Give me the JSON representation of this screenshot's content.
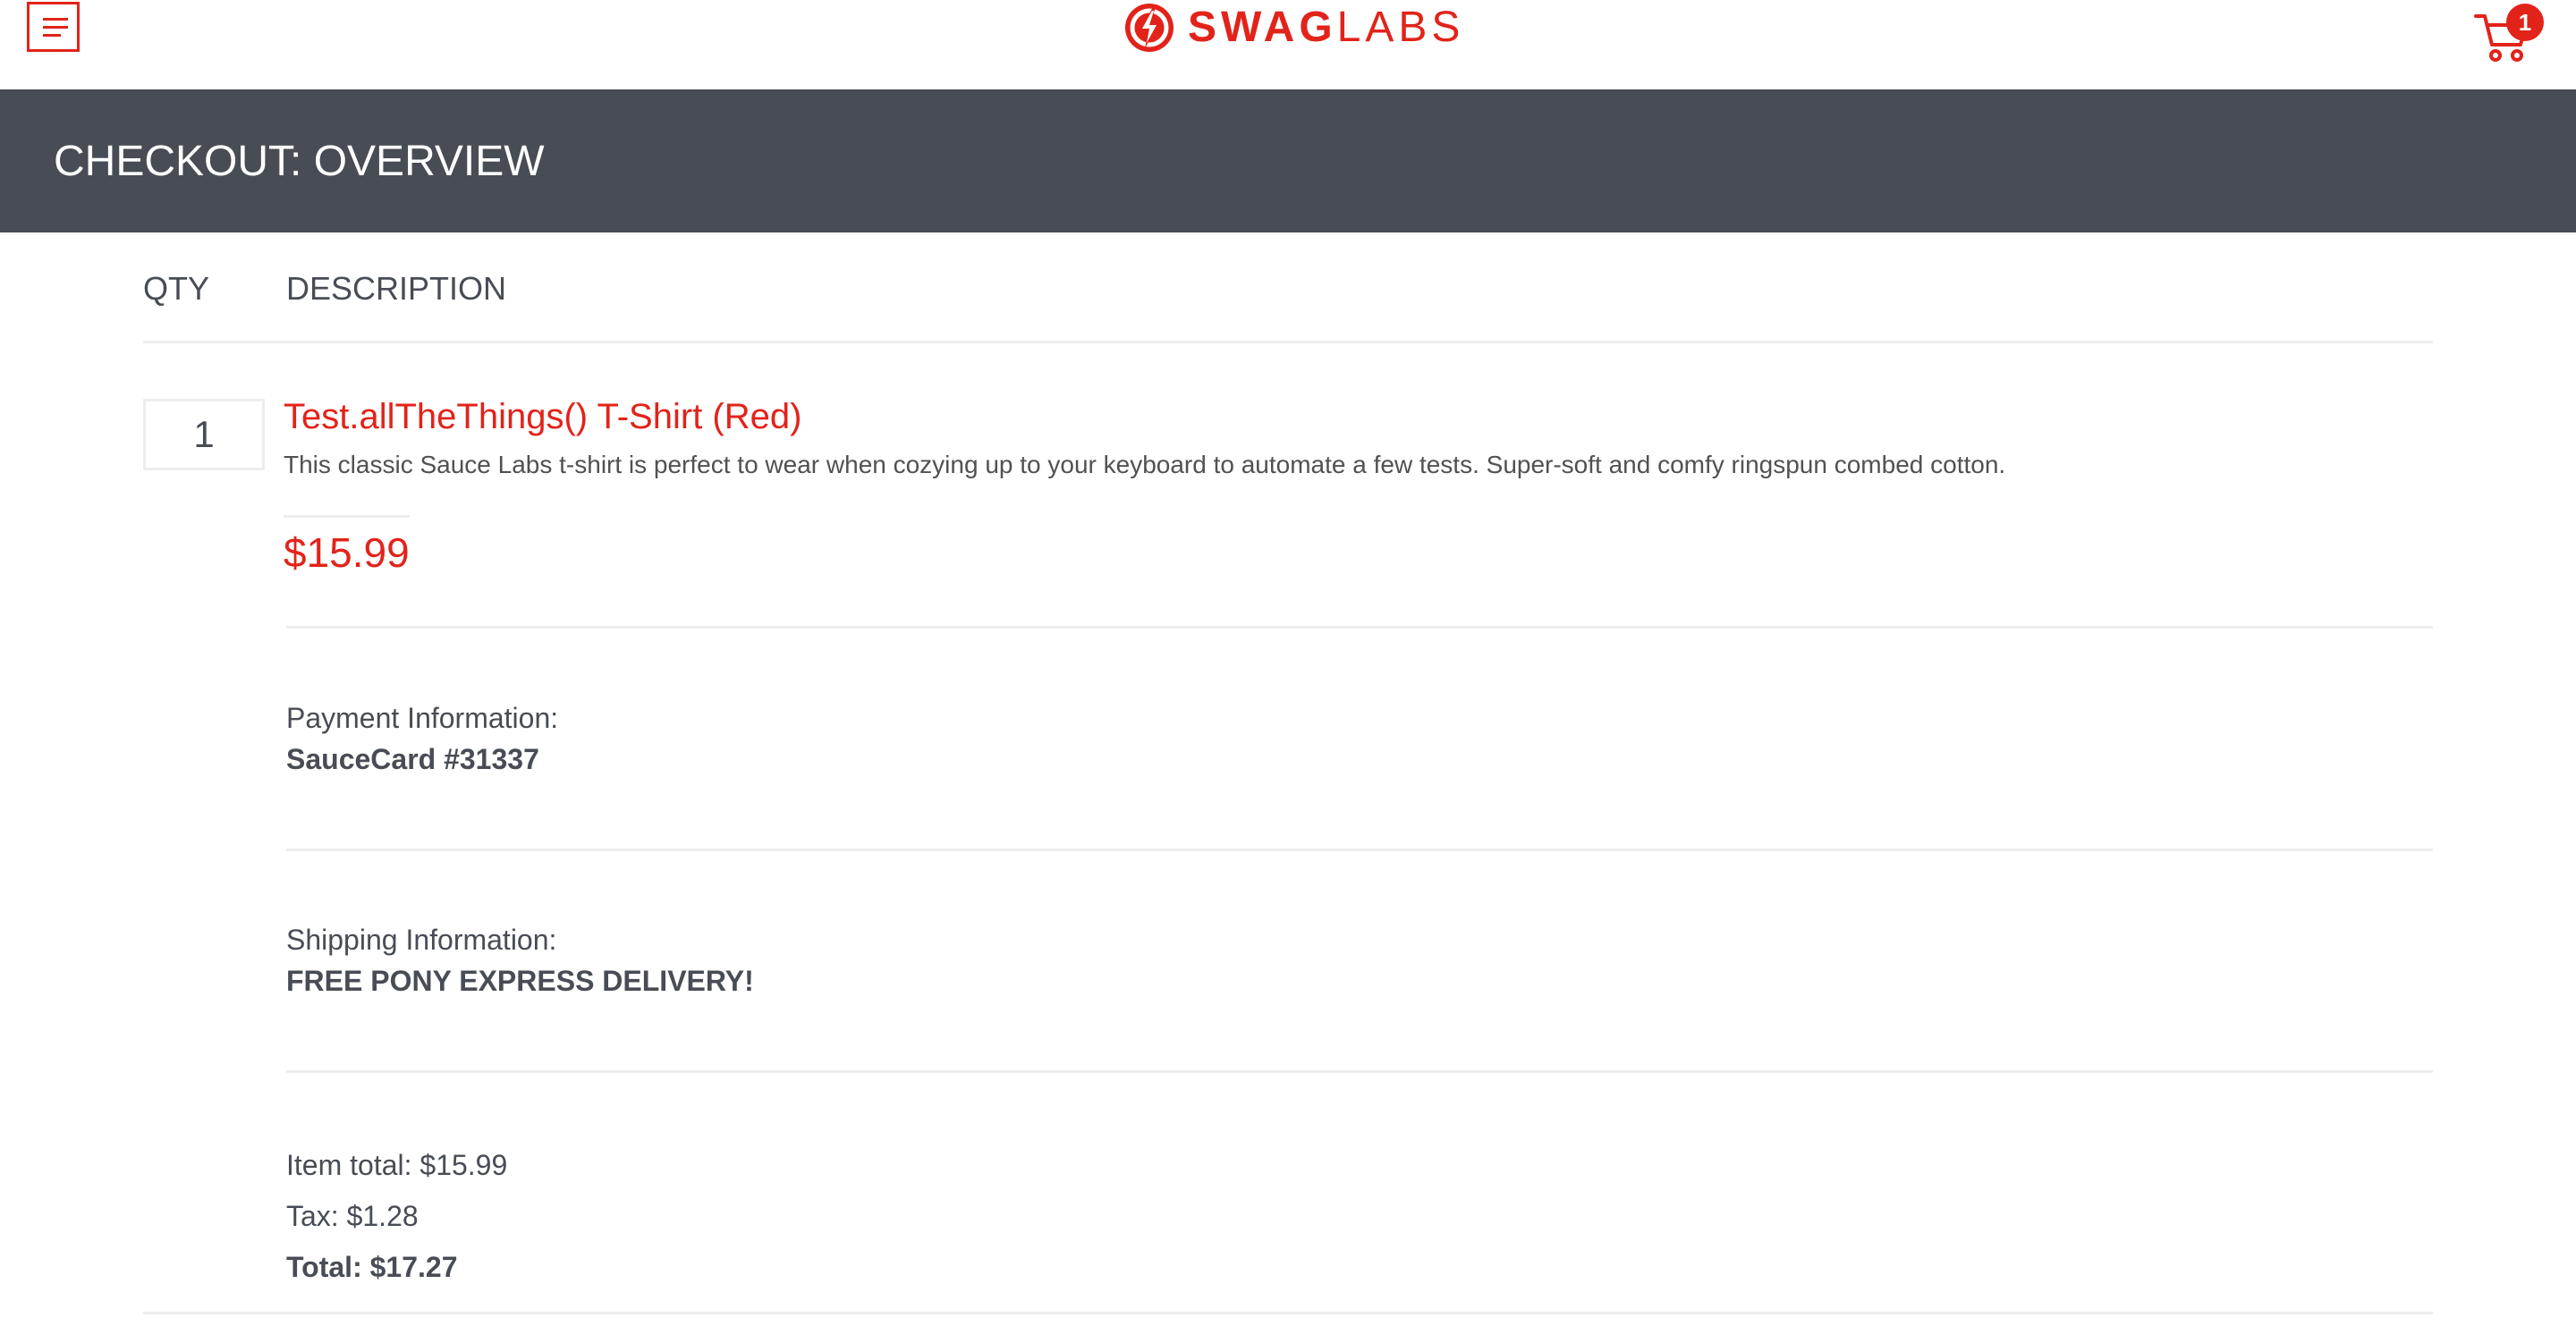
{
  "header": {
    "menu_icon": "hamburger-menu-icon",
    "logo_icon": "swag-labs-logo-icon",
    "logo_text_bold": "SWAG",
    "logo_text_light": "LABS",
    "cart_icon": "shopping-cart-icon",
    "cart_count": "1"
  },
  "page": {
    "title": "CHECKOUT: OVERVIEW"
  },
  "cart_list": {
    "qty_header": "QTY",
    "description_header": "DESCRIPTION",
    "items": [
      {
        "quantity": "1",
        "name": "Test.allTheThings() T-Shirt (Red)",
        "description": "This classic Sauce Labs t-shirt is perfect to wear when cozying up to your keyboard to automate a few tests. Super-soft and comfy ringspun combed cotton.",
        "price": "$15.99"
      }
    ]
  },
  "summary": {
    "payment_label": "Payment Information:",
    "payment_value": "SauceCard #31337",
    "shipping_label": "Shipping Information:",
    "shipping_value": "FREE PONY EXPRESS DELIVERY!",
    "item_total": "Item total: $15.99",
    "tax": "Tax: $1.28",
    "total": "Total: $17.27"
  },
  "colors": {
    "brand_red": "#e2231a",
    "header_bar": "#474c55",
    "text": "#484c55",
    "divider": "#ededef"
  }
}
